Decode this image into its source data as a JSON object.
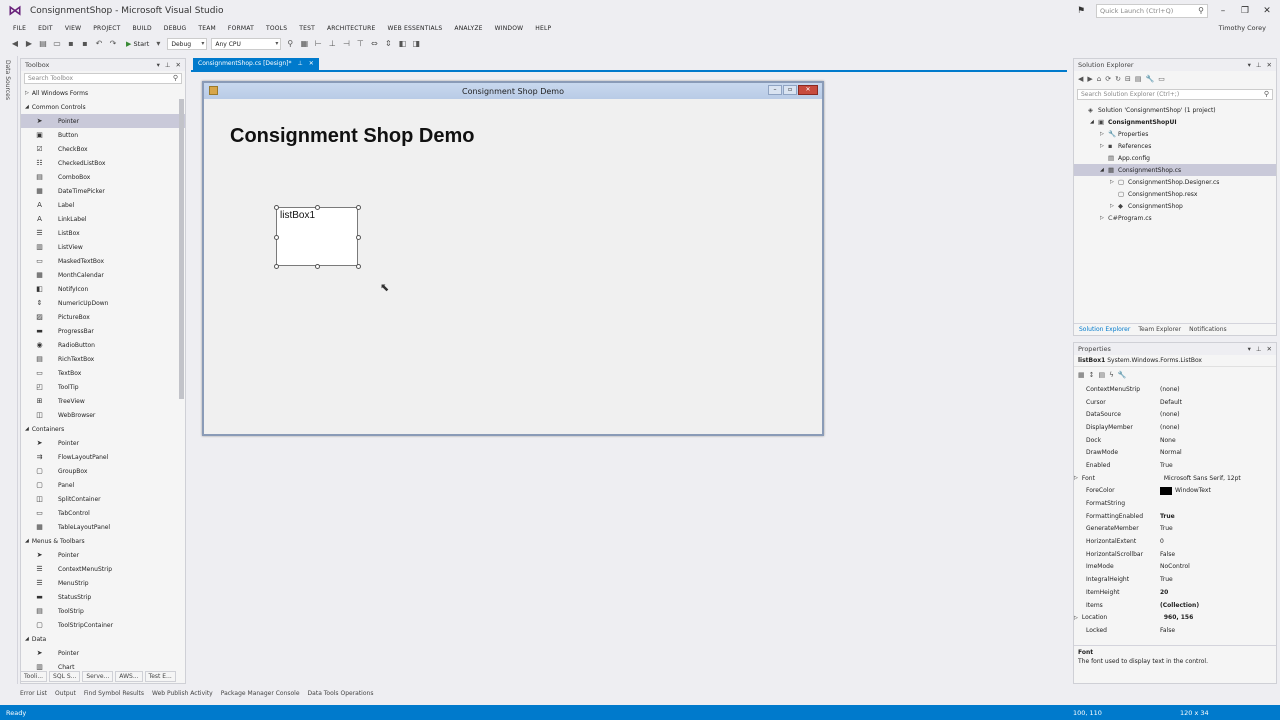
{
  "window": {
    "title": "ConsignmentShop - Microsoft Visual Studio",
    "quick_launch_placeholder": "Quick Launch (Ctrl+Q)",
    "user": "Timothy Corey"
  },
  "menu": [
    "FILE",
    "EDIT",
    "VIEW",
    "PROJECT",
    "BUILD",
    "DEBUG",
    "TEAM",
    "FORMAT",
    "TOOLS",
    "TEST",
    "ARCHITECTURE",
    "WEB ESSENTIALS",
    "ANALYZE",
    "WINDOW",
    "HELP"
  ],
  "toolbar": {
    "start_label": "Start",
    "config_value": "Debug",
    "platform_value": "Any CPU"
  },
  "left_strip": {
    "label": "Data Sources"
  },
  "toolbox": {
    "title": "Toolbox",
    "search_placeholder": "Search Toolbox",
    "rows": [
      {
        "kind": "cat",
        "label": "All Windows Forms",
        "expanded": false
      },
      {
        "kind": "cat",
        "label": "Common Controls",
        "expanded": true
      },
      {
        "kind": "item",
        "label": "Pointer",
        "icon": "pointer-icon",
        "glyph": "➤",
        "selected": true
      },
      {
        "kind": "item",
        "label": "Button",
        "icon": "button-icon",
        "glyph": "▣"
      },
      {
        "kind": "item",
        "label": "CheckBox",
        "icon": "checkbox-icon",
        "glyph": "☑"
      },
      {
        "kind": "item",
        "label": "CheckedListBox",
        "icon": "checked-list-icon",
        "glyph": "☷"
      },
      {
        "kind": "item",
        "label": "ComboBox",
        "icon": "combobox-icon",
        "glyph": "▤"
      },
      {
        "kind": "item",
        "label": "DateTimePicker",
        "icon": "calendar-icon",
        "glyph": "▦"
      },
      {
        "kind": "item",
        "label": "Label",
        "icon": "label-icon",
        "glyph": "A"
      },
      {
        "kind": "item",
        "label": "LinkLabel",
        "icon": "link-label-icon",
        "glyph": "A"
      },
      {
        "kind": "item",
        "label": "ListBox",
        "icon": "listbox-icon",
        "glyph": "☰"
      },
      {
        "kind": "item",
        "label": "ListView",
        "icon": "listview-icon",
        "glyph": "▥"
      },
      {
        "kind": "item",
        "label": "MaskedTextBox",
        "icon": "masked-textbox-icon",
        "glyph": "▭"
      },
      {
        "kind": "item",
        "label": "MonthCalendar",
        "icon": "month-calendar-icon",
        "glyph": "▦"
      },
      {
        "kind": "item",
        "label": "NotifyIcon",
        "icon": "notify-icon",
        "glyph": "◧"
      },
      {
        "kind": "item",
        "label": "NumericUpDown",
        "icon": "numeric-updown-icon",
        "glyph": "⇕"
      },
      {
        "kind": "item",
        "label": "PictureBox",
        "icon": "picturebox-icon",
        "glyph": "▨"
      },
      {
        "kind": "item",
        "label": "ProgressBar",
        "icon": "progressbar-icon",
        "glyph": "▬"
      },
      {
        "kind": "item",
        "label": "RadioButton",
        "icon": "radio-icon",
        "glyph": "◉"
      },
      {
        "kind": "item",
        "label": "RichTextBox",
        "icon": "richtextbox-icon",
        "glyph": "▤"
      },
      {
        "kind": "item",
        "label": "TextBox",
        "icon": "textbox-icon",
        "glyph": "▭"
      },
      {
        "kind": "item",
        "label": "ToolTip",
        "icon": "tooltip-icon",
        "glyph": "◰"
      },
      {
        "kind": "item",
        "label": "TreeView",
        "icon": "treeview-icon",
        "glyph": "⊞"
      },
      {
        "kind": "item",
        "label": "WebBrowser",
        "icon": "webbrowser-icon",
        "glyph": "◫"
      },
      {
        "kind": "cat",
        "label": "Containers",
        "expanded": true
      },
      {
        "kind": "item",
        "label": "Pointer",
        "icon": "pointer-icon",
        "glyph": "➤"
      },
      {
        "kind": "item",
        "label": "FlowLayoutPanel",
        "icon": "flow-layout-icon",
        "glyph": "⇉"
      },
      {
        "kind": "item",
        "label": "GroupBox",
        "icon": "groupbox-icon",
        "glyph": "▢"
      },
      {
        "kind": "item",
        "label": "Panel",
        "icon": "panel-icon",
        "glyph": "▢"
      },
      {
        "kind": "item",
        "label": "SplitContainer",
        "icon": "split-container-icon",
        "glyph": "◫"
      },
      {
        "kind": "item",
        "label": "TabControl",
        "icon": "tabcontrol-icon",
        "glyph": "▭"
      },
      {
        "kind": "item",
        "label": "TableLayoutPanel",
        "icon": "table-layout-icon",
        "glyph": "▦"
      },
      {
        "kind": "cat",
        "label": "Menus & Toolbars",
        "expanded": true
      },
      {
        "kind": "item",
        "label": "Pointer",
        "icon": "pointer-icon",
        "glyph": "➤"
      },
      {
        "kind": "item",
        "label": "ContextMenuStrip",
        "icon": "context-menu-icon",
        "glyph": "☰"
      },
      {
        "kind": "item",
        "label": "MenuStrip",
        "icon": "menustrip-icon",
        "glyph": "☰"
      },
      {
        "kind": "item",
        "label": "StatusStrip",
        "icon": "statusstrip-icon",
        "glyph": "▬"
      },
      {
        "kind": "item",
        "label": "ToolStrip",
        "icon": "toolstrip-icon",
        "glyph": "▤"
      },
      {
        "kind": "item",
        "label": "ToolStripContainer",
        "icon": "toolstrip-container-icon",
        "glyph": "▢"
      },
      {
        "kind": "cat",
        "label": "Data",
        "expanded": true
      },
      {
        "kind": "item",
        "label": "Pointer",
        "icon": "pointer-icon",
        "glyph": "➤"
      },
      {
        "kind": "item",
        "label": "Chart",
        "icon": "chart-icon",
        "glyph": "▥"
      }
    ],
    "bottom_tabs": [
      "Tooli...",
      "SQL S...",
      "Serve...",
      "AWS...",
      "Test E..."
    ]
  },
  "document": {
    "tab_label": "ConsignmentShop.cs [Design]*",
    "form_title": "Consignment Shop Demo",
    "heading": "Consignment Shop Demo",
    "listbox_text": "listBox1"
  },
  "solution_explorer": {
    "title": "Solution Explorer",
    "search_placeholder": "Search Solution Explorer (Ctrl+;)",
    "tree": [
      {
        "indent": 0,
        "tri": "",
        "icon": "solution-icon",
        "glyph": "◈",
        "label": "Solution 'ConsignmentShop' (1 project)"
      },
      {
        "indent": 1,
        "tri": "◢",
        "icon": "csharp-project-icon",
        "glyph": "▣",
        "label": "ConsignmentShopUI",
        "bold": true
      },
      {
        "indent": 2,
        "tri": "▷",
        "icon": "wrench-icon",
        "glyph": "🔧",
        "label": "Properties"
      },
      {
        "indent": 2,
        "tri": "▷",
        "icon": "references-icon",
        "glyph": "▪",
        "label": "References"
      },
      {
        "indent": 2,
        "tri": "",
        "icon": "config-file-icon",
        "glyph": "▤",
        "label": "App.config"
      },
      {
        "indent": 2,
        "tri": "◢",
        "icon": "form-file-icon",
        "glyph": "▦",
        "label": "ConsignmentShop.cs",
        "selected": true
      },
      {
        "indent": 3,
        "tri": "▷",
        "icon": "cs-file-icon",
        "glyph": "▢",
        "label": "ConsignmentShop.Designer.cs"
      },
      {
        "indent": 3,
        "tri": "",
        "icon": "resx-file-icon",
        "glyph": "▢",
        "label": "ConsignmentShop.resx"
      },
      {
        "indent": 3,
        "tri": "▷",
        "icon": "class-icon",
        "glyph": "◆",
        "label": "ConsignmentShop"
      },
      {
        "indent": 2,
        "tri": "▷",
        "icon": "cs-file-icon",
        "glyph": "C#",
        "label": "Program.cs"
      }
    ],
    "tabs": [
      "Solution Explorer",
      "Team Explorer",
      "Notifications"
    ]
  },
  "properties": {
    "title": "Properties",
    "object_name": "listBox1",
    "object_type": "System.Windows.Forms.ListBox",
    "rows": [
      {
        "name": "ContextMenuStrip",
        "value": "(none)"
      },
      {
        "name": "Cursor",
        "value": "Default"
      },
      {
        "name": "DataSource",
        "value": "(none)"
      },
      {
        "name": "DisplayMember",
        "value": "(none)"
      },
      {
        "name": "Dock",
        "value": "None"
      },
      {
        "name": "DrawMode",
        "value": "Normal"
      },
      {
        "name": "Enabled",
        "value": "True"
      },
      {
        "name": "Font",
        "value": "Microsoft Sans Serif, 12pt",
        "expandable": true
      },
      {
        "name": "ForeColor",
        "value": "WindowText",
        "swatch": "#000000"
      },
      {
        "name": "FormatString",
        "value": ""
      },
      {
        "name": "FormattingEnabled",
        "value": "True",
        "bold": true
      },
      {
        "name": "GenerateMember",
        "value": "True"
      },
      {
        "name": "HorizontalExtent",
        "value": "0"
      },
      {
        "name": "HorizontalScrollbar",
        "value": "False"
      },
      {
        "name": "ImeMode",
        "value": "NoControl"
      },
      {
        "name": "IntegralHeight",
        "value": "True"
      },
      {
        "name": "ItemHeight",
        "value": "20",
        "bold": true
      },
      {
        "name": "Items",
        "value": "(Collection)",
        "bold": true
      },
      {
        "name": "Location",
        "value": "960, 156",
        "bold": true,
        "expandable": true
      },
      {
        "name": "Locked",
        "value": "False"
      }
    ],
    "desc_title": "Font",
    "desc_text": "The font used to display text in the control."
  },
  "output_tabs": [
    "Error List",
    "Output",
    "Find Symbol Results",
    "Web Publish Activity",
    "Package Manager Console",
    "Data Tools Operations"
  ],
  "status": {
    "left": "Ready",
    "position": "100, 110",
    "size": "120 x 34"
  },
  "colors": {
    "accent": "#007acc",
    "vs_purple": "#68217a",
    "selection": "#c9c9d9"
  }
}
